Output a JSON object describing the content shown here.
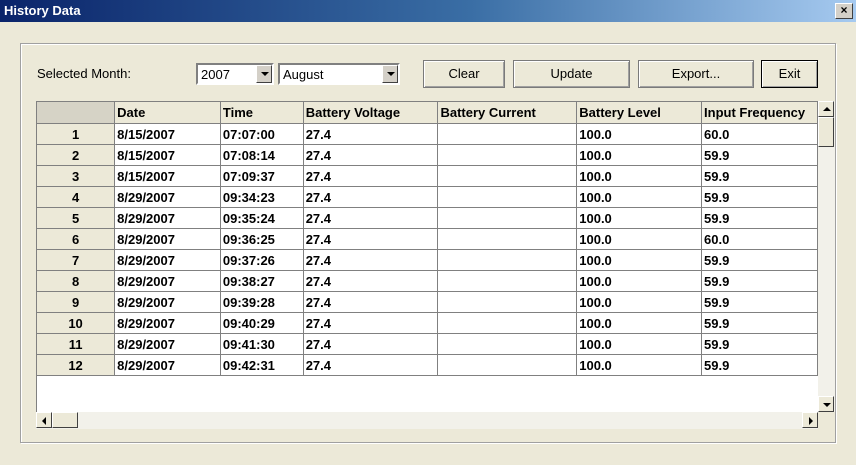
{
  "window": {
    "title": "History Data",
    "close_label": "×"
  },
  "controls": {
    "month_label": "Selected Month:",
    "year": "2007",
    "month": "August",
    "clear_label": "Clear",
    "update_label": "Update",
    "export_label": "Export...",
    "exit_label": "Exit"
  },
  "grid": {
    "columns": [
      "Date",
      "Time",
      "Battery Voltage",
      "Battery Current",
      "Battery Level",
      "Input Frequency"
    ],
    "rows": [
      {
        "n": "1",
        "date": "8/15/2007",
        "time": "07:07:00",
        "bv": "27.4",
        "bc": "",
        "bl": "100.0",
        "freq": "60.0"
      },
      {
        "n": "2",
        "date": "8/15/2007",
        "time": "07:08:14",
        "bv": "27.4",
        "bc": "",
        "bl": "100.0",
        "freq": "59.9"
      },
      {
        "n": "3",
        "date": "8/15/2007",
        "time": "07:09:37",
        "bv": "27.4",
        "bc": "",
        "bl": "100.0",
        "freq": "59.9"
      },
      {
        "n": "4",
        "date": "8/29/2007",
        "time": "09:34:23",
        "bv": "27.4",
        "bc": "",
        "bl": "100.0",
        "freq": "59.9"
      },
      {
        "n": "5",
        "date": "8/29/2007",
        "time": "09:35:24",
        "bv": "27.4",
        "bc": "",
        "bl": "100.0",
        "freq": "59.9"
      },
      {
        "n": "6",
        "date": "8/29/2007",
        "time": "09:36:25",
        "bv": "27.4",
        "bc": "",
        "bl": "100.0",
        "freq": "60.0"
      },
      {
        "n": "7",
        "date": "8/29/2007",
        "time": "09:37:26",
        "bv": "27.4",
        "bc": "",
        "bl": "100.0",
        "freq": "59.9"
      },
      {
        "n": "8",
        "date": "8/29/2007",
        "time": "09:38:27",
        "bv": "27.4",
        "bc": "",
        "bl": "100.0",
        "freq": "59.9"
      },
      {
        "n": "9",
        "date": "8/29/2007",
        "time": "09:39:28",
        "bv": "27.4",
        "bc": "",
        "bl": "100.0",
        "freq": "59.9"
      },
      {
        "n": "10",
        "date": "8/29/2007",
        "time": "09:40:29",
        "bv": "27.4",
        "bc": "",
        "bl": "100.0",
        "freq": "59.9"
      },
      {
        "n": "11",
        "date": "8/29/2007",
        "time": "09:41:30",
        "bv": "27.4",
        "bc": "",
        "bl": "100.0",
        "freq": "59.9"
      },
      {
        "n": "12",
        "date": "8/29/2007",
        "time": "09:42:31",
        "bv": "27.4",
        "bc": "",
        "bl": "100.0",
        "freq": "59.9"
      }
    ]
  }
}
